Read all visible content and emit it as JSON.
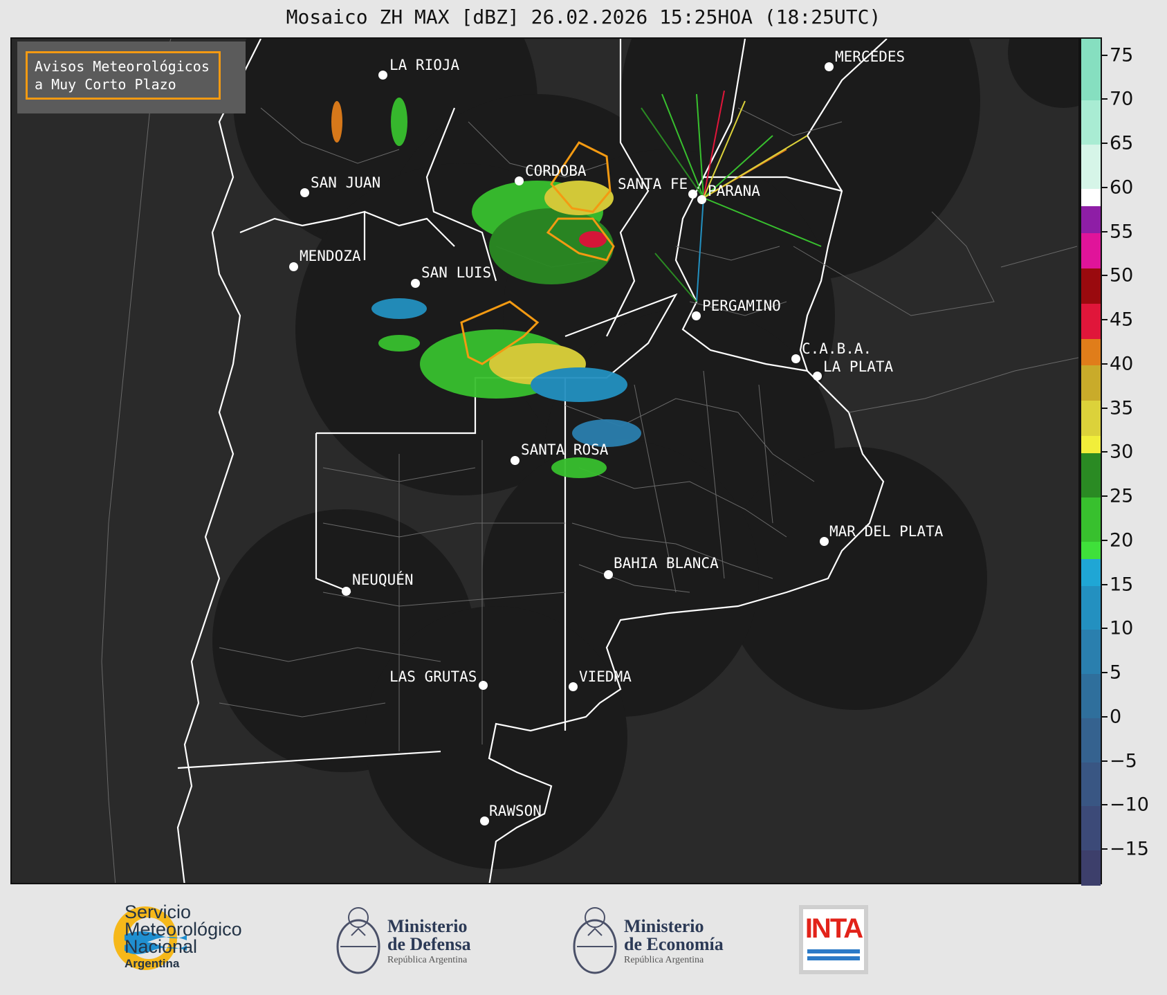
{
  "title": "Mosaico ZH MAX [dBZ] 26.02.2026 15:25HOA (18:25UTC)",
  "warning_box": {
    "line1": "Avisos Meteorológicos",
    "line2": "a Muy Corto Plazo",
    "color": "#f39a12"
  },
  "cities": [
    {
      "name": "LA RIOJA"
    },
    {
      "name": "MERCEDES"
    },
    {
      "name": "SAN JUAN"
    },
    {
      "name": "CORDOBA"
    },
    {
      "name": "SANTA FE"
    },
    {
      "name": "PARANA"
    },
    {
      "name": "MENDOZA"
    },
    {
      "name": "SAN LUIS"
    },
    {
      "name": "PERGAMINO"
    },
    {
      "name": "C.A.B.A."
    },
    {
      "name": "LA PLATA"
    },
    {
      "name": "SANTA ROSA"
    },
    {
      "name": "MAR DEL PLATA"
    },
    {
      "name": "BAHIA BLANCA"
    },
    {
      "name": "NEUQUÉN"
    },
    {
      "name": "LAS GRUTAS"
    },
    {
      "name": "VIEDMA"
    },
    {
      "name": "RAWSON"
    }
  ],
  "colorbar": {
    "unit": "dBZ",
    "range": [
      -19,
      77
    ],
    "ticks": [
      "75",
      "70",
      "65",
      "60",
      "55",
      "50",
      "45",
      "40",
      "35",
      "30",
      "25",
      "20",
      "15",
      "10",
      "5",
      "0",
      "−5",
      "−10",
      "−15"
    ],
    "bands": [
      {
        "from": -19,
        "to": -15,
        "color": "#3d3f6b"
      },
      {
        "from": -15,
        "to": -10,
        "color": "#3c4a78"
      },
      {
        "from": -10,
        "to": -5,
        "color": "#395683"
      },
      {
        "from": -5,
        "to": 0,
        "color": "#35628f"
      },
      {
        "from": 0,
        "to": 5,
        "color": "#2f6f9c"
      },
      {
        "from": 5,
        "to": 10,
        "color": "#2a7fae"
      },
      {
        "from": 10,
        "to": 15,
        "color": "#2390c0"
      },
      {
        "from": 15,
        "to": 18,
        "color": "#1fa6d5"
      },
      {
        "from": 18,
        "to": 20,
        "color": "#3fe03a"
      },
      {
        "from": 20,
        "to": 25,
        "color": "#38c02e"
      },
      {
        "from": 25,
        "to": 30,
        "color": "#2a8a23"
      },
      {
        "from": 30,
        "to": 32,
        "color": "#f1ee3a"
      },
      {
        "from": 32,
        "to": 36,
        "color": "#dcd23a"
      },
      {
        "from": 36,
        "to": 40,
        "color": "#c9ab2a"
      },
      {
        "from": 40,
        "to": 43,
        "color": "#e07d1a"
      },
      {
        "from": 43,
        "to": 47,
        "color": "#e0163a"
      },
      {
        "from": 47,
        "to": 51,
        "color": "#9a0a0e"
      },
      {
        "from": 51,
        "to": 55,
        "color": "#e0149a"
      },
      {
        "from": 55,
        "to": 58,
        "color": "#8e1ea6"
      },
      {
        "from": 58,
        "to": 60,
        "color": "#ffffff"
      },
      {
        "from": 60,
        "to": 65,
        "color": "#d6f5e8"
      },
      {
        "from": 65,
        "to": 70,
        "color": "#a9ecd3"
      },
      {
        "from": 70,
        "to": 77,
        "color": "#86dfc0"
      }
    ]
  },
  "footer": {
    "smn": {
      "line1": "Servicio",
      "line2": "Meteorológico",
      "line3": "Nacional",
      "line4": "Argentina"
    },
    "defensa": {
      "line1": "Ministerio",
      "line2": "de Defensa",
      "line3": "República Argentina"
    },
    "economia": {
      "line1": "Ministerio",
      "line2": "de Economía",
      "line3": "República Argentina"
    },
    "inta": "INTA"
  }
}
